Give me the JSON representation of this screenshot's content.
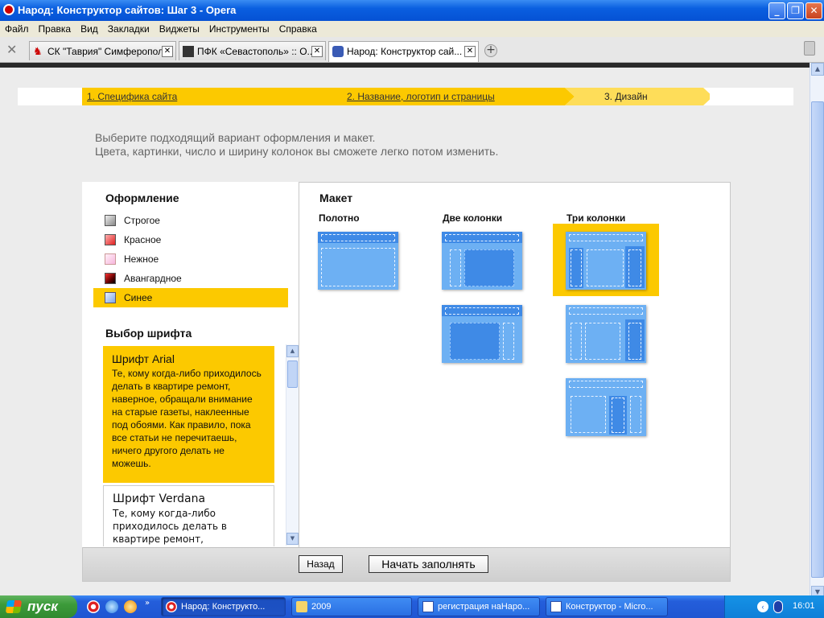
{
  "window": {
    "title": "Народ: Конструктор сайтов: Шаг 3 - Opera"
  },
  "menu": [
    "Файл",
    "Правка",
    "Вид",
    "Закладки",
    "Виджеты",
    "Инструменты",
    "Справка"
  ],
  "tabs": [
    {
      "label": "СК \"Таврия\" Симферопол..."
    },
    {
      "label": "ПФК «Севастополь» :: О..."
    },
    {
      "label": "Народ: Конструктор сай..."
    }
  ],
  "steps": {
    "step1": "1. Специфика сайта",
    "step2": "2. Название, логотип и страницы",
    "step3": "3. Дизайн"
  },
  "intro": {
    "line1": "Выберите подходящий вариант оформления и макет.",
    "line2": "Цвета, картинки, число и ширину колонок вы сможете легко потом изменить."
  },
  "design": {
    "title": "Оформление",
    "styles": [
      {
        "label": "Строгое",
        "color": "#9a9a9a"
      },
      {
        "label": "Красное",
        "color": "#e83a3a"
      },
      {
        "label": "Нежное",
        "color": "#f7b6dc"
      },
      {
        "label": "Авангардное",
        "color": "#b00000"
      },
      {
        "label": "Синее",
        "color": "#7ea7e8",
        "selected": true
      }
    ]
  },
  "fonts": {
    "title": "Выбор шрифта",
    "items": [
      {
        "name": "Шрифт Arial",
        "text": "Те, кому когда-либо приходилось делать в квартире ремонт, наверное, обращали внимание на старые газеты, наклеенные под обоями. Как правило, пока все статьи не перечитаешь, ничего другого делать не можешь.",
        "selected": true
      },
      {
        "name": "Шрифт Verdana",
        "text": "Те, кому когда-либо приходилось делать в квартире ремонт,"
      }
    ]
  },
  "layout": {
    "title": "Макет",
    "columns": [
      "Полотно",
      "Две колонки",
      "Три колонки"
    ]
  },
  "buttons": {
    "back": "Назад",
    "start": "Начать заполнять"
  },
  "taskbar": {
    "start": "пуск",
    "tasks": [
      "Народ: Конструкто...",
      "2009",
      "регистрация наНаро...",
      "Конструктор - Micro..."
    ],
    "lang": "EN",
    "clock": "16:01"
  },
  "colors": {
    "accent": "#fcc900",
    "layout_blue": "#6db0f3",
    "layout_dark": "#3f8ae6"
  }
}
